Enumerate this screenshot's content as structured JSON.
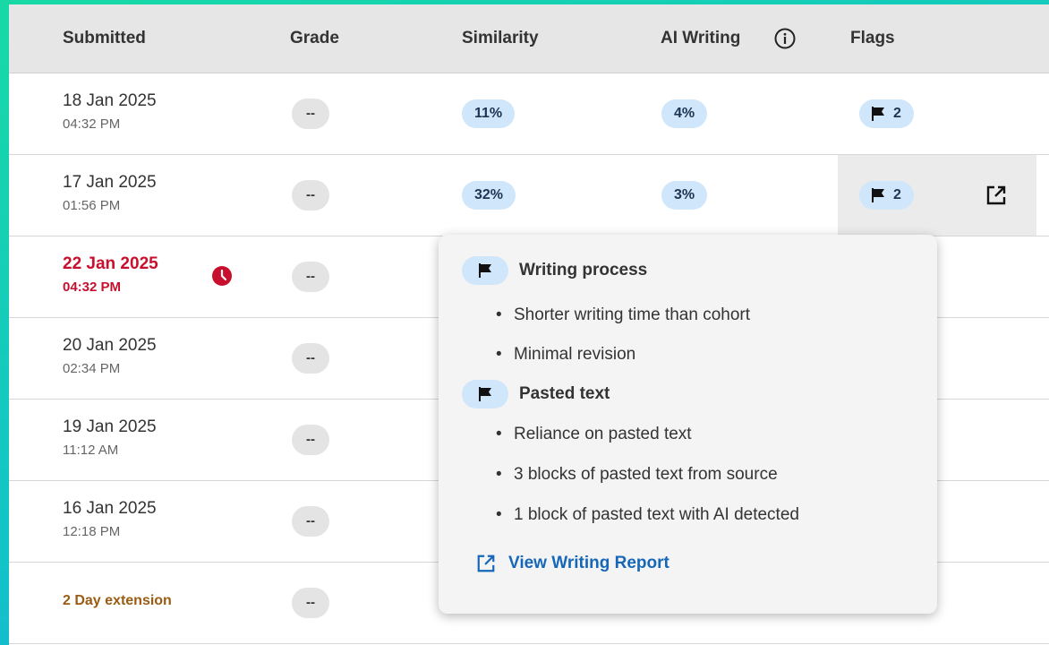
{
  "header": {
    "submitted": "Submitted",
    "grade": "Grade",
    "similarity": "Similarity",
    "ai_writing": "AI Writing",
    "flags": "Flags"
  },
  "rows": [
    {
      "date": "18 Jan 2025",
      "time": "04:32 PM",
      "grade": "--",
      "similarity": "11%",
      "ai": "4%",
      "flags": "2"
    },
    {
      "date": "17 Jan 2025",
      "time": "01:56 PM",
      "grade": "--",
      "similarity": "32%",
      "ai": "3%",
      "flags": "2"
    },
    {
      "date": "22 Jan 2025",
      "time": "04:32 PM",
      "grade": "--"
    },
    {
      "date": "20 Jan 2025",
      "time": "02:34 PM",
      "grade": "--"
    },
    {
      "date": "19 Jan 2025",
      "time": "11:12 AM",
      "grade": "--"
    },
    {
      "date": "16 Jan 2025",
      "time": "12:18 PM",
      "grade": "--"
    },
    {
      "extension": "2 Day extension",
      "grade": "--"
    }
  ],
  "popover": {
    "categories": [
      {
        "label": "Writing process",
        "items": [
          "Shorter writing time than cohort",
          "Minimal revision"
        ]
      },
      {
        "label": "Pasted text",
        "items": [
          "Reliance on pasted text",
          "3 blocks of pasted text from source",
          "1 block of pasted text with AI detected"
        ]
      }
    ],
    "bullet": "•",
    "link": "View Writing Report"
  },
  "icons": {
    "info": "info-icon",
    "flag": "flag-icon",
    "clock": "clock-icon",
    "external_link": "external-link-icon"
  },
  "colors": {
    "pill_bg": "#cfe6fb",
    "late_red": "#c8102e",
    "extension_brown": "#9a5b12",
    "link_blue": "#1667b8",
    "background_gradient_start": "#18d9a6",
    "background_gradient_end": "#1aa6e0"
  }
}
